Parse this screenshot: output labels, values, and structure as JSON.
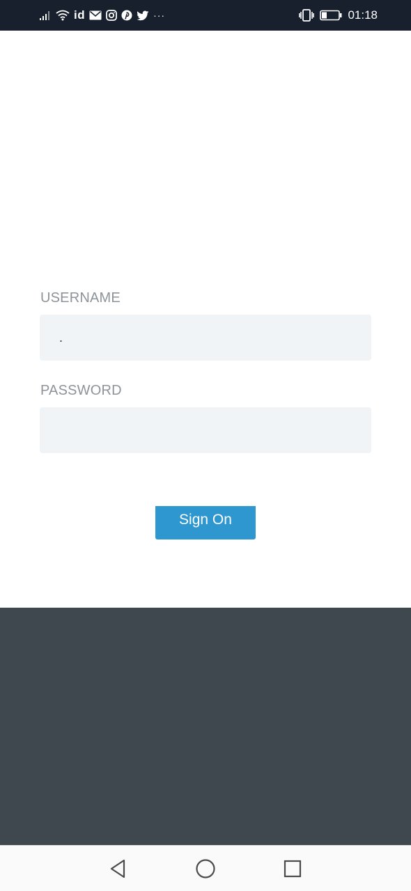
{
  "status_bar": {
    "carrier_badge": "id",
    "overflow": "···",
    "time": "01:18",
    "icons_left": [
      "signal-icon",
      "wifi-icon",
      "mail-icon",
      "instagram-icon",
      "pinterest-icon",
      "twitter-icon"
    ],
    "icons_right": [
      "vibrate-icon",
      "battery-icon"
    ]
  },
  "form": {
    "username_label": "USERNAME",
    "username_value": ".",
    "password_label": "PASSWORD",
    "password_value": "",
    "sign_on_label": "Sign On"
  },
  "colors": {
    "status_bar_bg": "#18202e",
    "input_bg": "#f0f4f7",
    "button_bg": "#2f97d0",
    "footer_bg": "#3f474f",
    "label_color": "#8d9399"
  },
  "nav_bar": {
    "buttons": [
      "back-icon",
      "home-icon",
      "recents-icon"
    ]
  }
}
